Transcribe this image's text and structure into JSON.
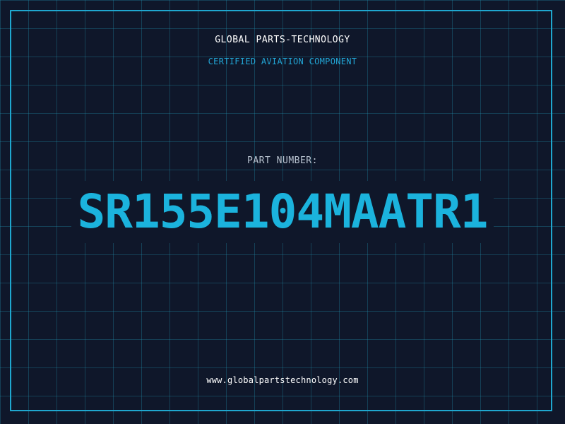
{
  "header": {
    "brand": "GLOBAL PARTS-TECHNOLOGY",
    "subtitle": "CERTIFIED AVIATION COMPONENT"
  },
  "part": {
    "label": "PART NUMBER:",
    "number": "SR155E104MAATR1"
  },
  "footer": {
    "url": "www.globalpartstechnology.com"
  },
  "colors": {
    "background": "#0f172a",
    "accent": "#1bb3dd",
    "grid": "#1f7f9a"
  }
}
